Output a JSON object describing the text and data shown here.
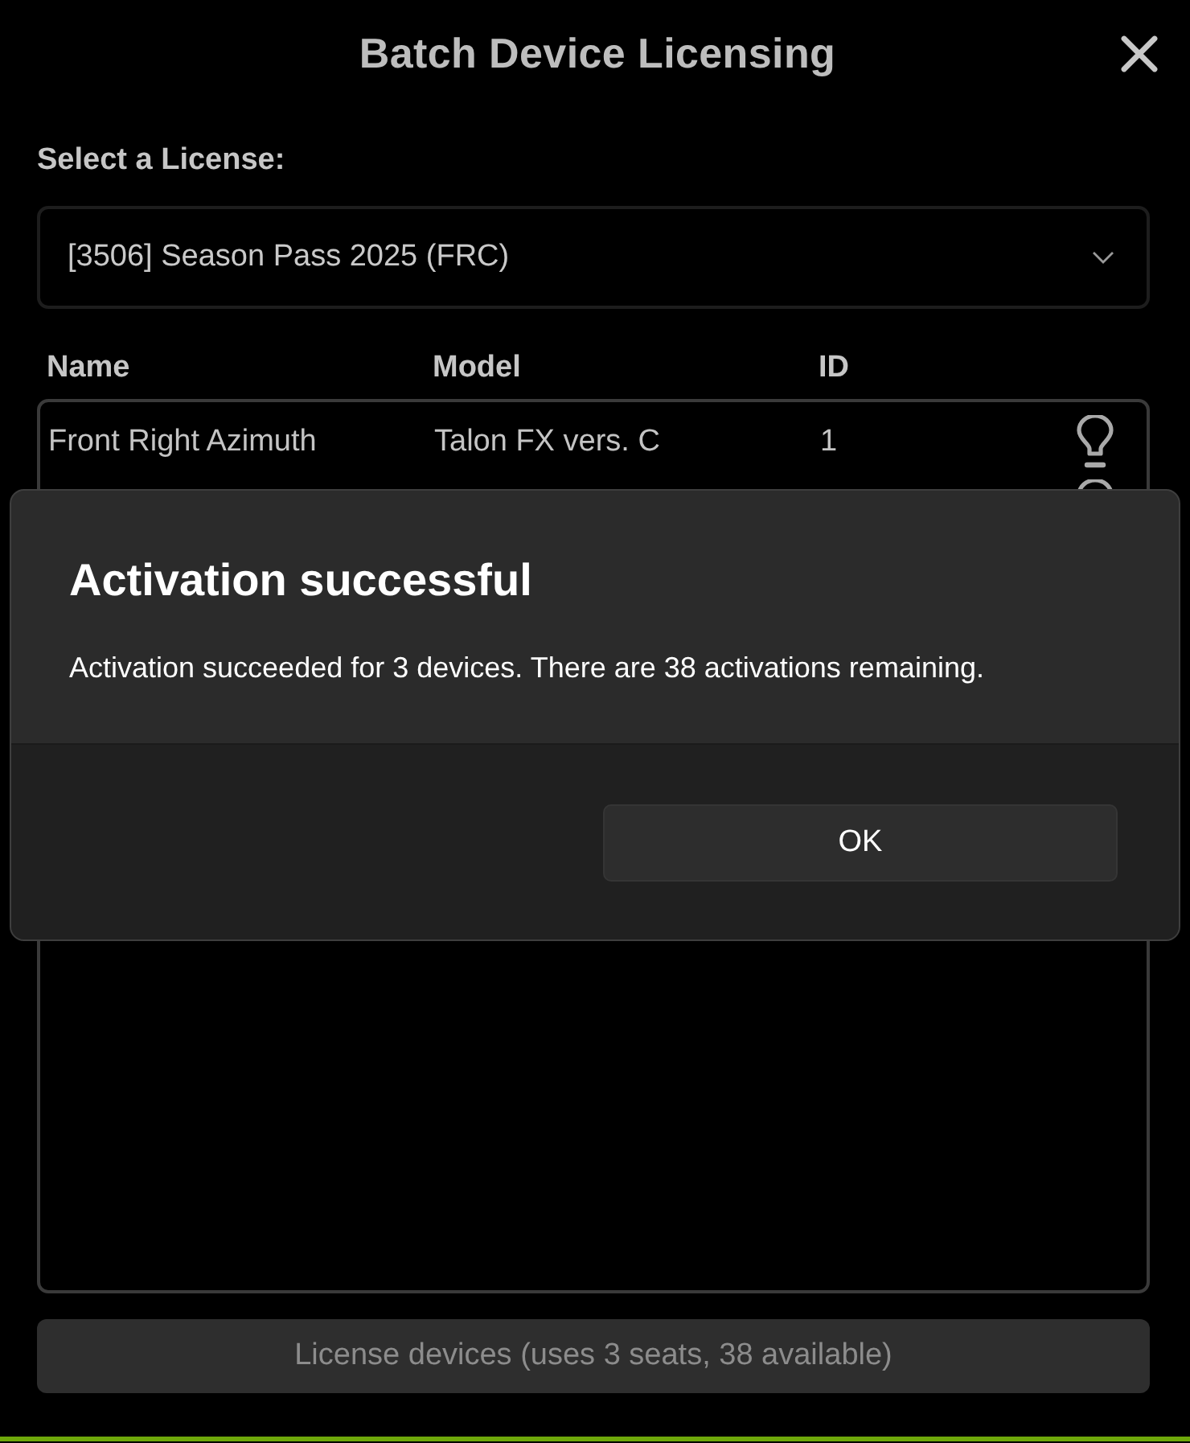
{
  "window": {
    "title": "Batch Device Licensing"
  },
  "license": {
    "label": "Select a License:",
    "value": "[3506] Season Pass 2025 (FRC)"
  },
  "table": {
    "columns": [
      "Name",
      "Model",
      "ID"
    ],
    "rows": [
      {
        "name": "Front Right Azimuth",
        "model": "Talon FX vers. C",
        "id": "1"
      },
      {}
    ]
  },
  "action_button": {
    "label": "License devices (uses 3 seats, 38 available)",
    "disabled": true
  },
  "dialog": {
    "title": "Activation successful",
    "message": "Activation succeeded for 3 devices. There are 38 activations remaining.",
    "buttons": [
      "OK"
    ]
  }
}
